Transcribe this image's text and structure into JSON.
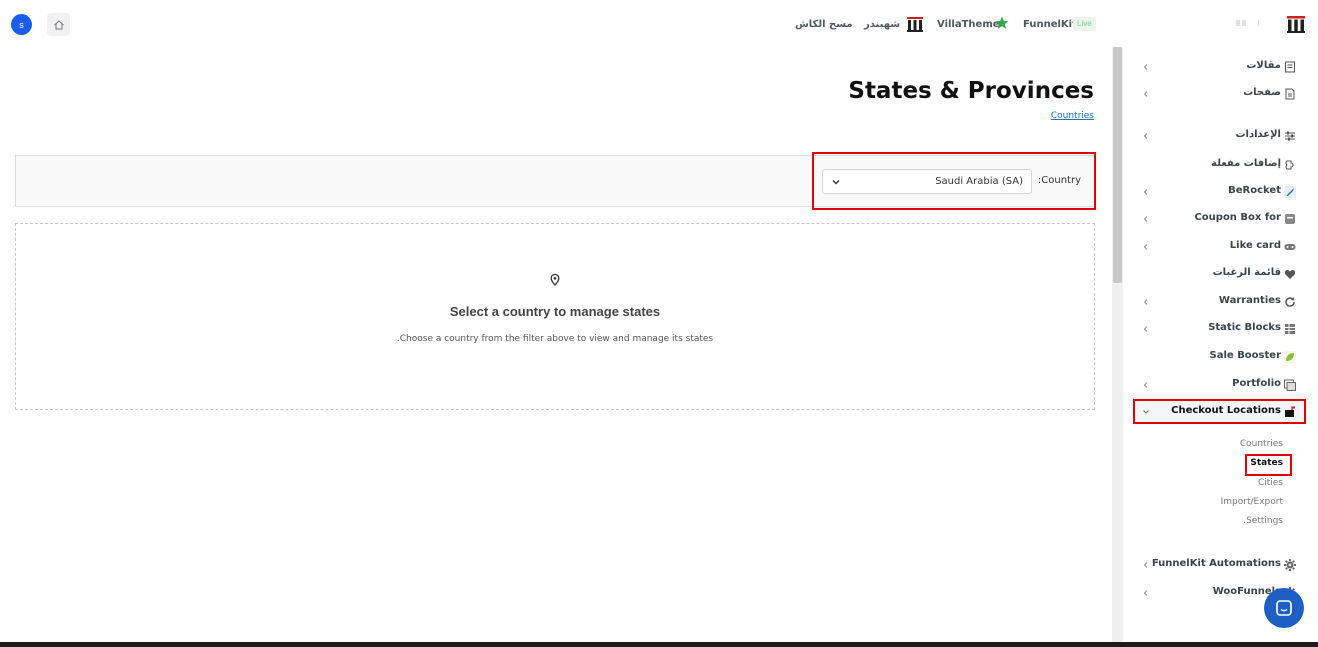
{
  "topbar": {
    "avatar_letter": "s",
    "nav": {
      "clear_cache": "مسح الكاش",
      "shabandar": "شهبندر",
      "villatheme": "VillaTheme",
      "funnelkit": "FunnelKit",
      "live_badge": "Live"
    }
  },
  "main": {
    "title": "States & Provinces",
    "countries_link": "Countries",
    "filter": {
      "label": ":Country",
      "selected": "Saudi Arabia (SA)"
    },
    "empty_state": {
      "title": "Select a country to manage states",
      "description": ".Choose a country from the filter above to view and manage its states"
    }
  },
  "sidebar": {
    "items": [
      {
        "label": "مقالات",
        "icon": "posts-icon"
      },
      {
        "label": "صفحات",
        "icon": "pages-icon"
      },
      {
        "label": "الإعدادات",
        "icon": "settings-sliders-icon"
      },
      {
        "label": "إضافات مفعلة",
        "icon": "plugin-icon"
      },
      {
        "label": "BeRocket",
        "icon": "rocket-icon"
      },
      {
        "label": "Coupon Box for",
        "icon": "coupon-box-icon"
      },
      {
        "label": "Like card",
        "icon": "gamepad-icon"
      },
      {
        "label": "قائمة الرغبات",
        "icon": "heart-icon"
      },
      {
        "label": "Warranties",
        "icon": "refresh-icon"
      },
      {
        "label": "Static Blocks",
        "icon": "grid-icon"
      },
      {
        "label": "Sale Booster",
        "icon": "leaf-icon"
      },
      {
        "label": "Portfolio",
        "icon": "portfolio-icon"
      },
      {
        "label": "Checkout Locations",
        "icon": "mailbox-icon"
      },
      {
        "label": "FunnelKit Automations",
        "icon": "gear-icon"
      },
      {
        "label": "WooFunnels",
        "icon": "gear-icon"
      }
    ],
    "submenu": {
      "countries": "Countries",
      "states": "States",
      "cities": "Cities",
      "import_export": "Import/Export",
      "settings": ".Settings"
    }
  }
}
